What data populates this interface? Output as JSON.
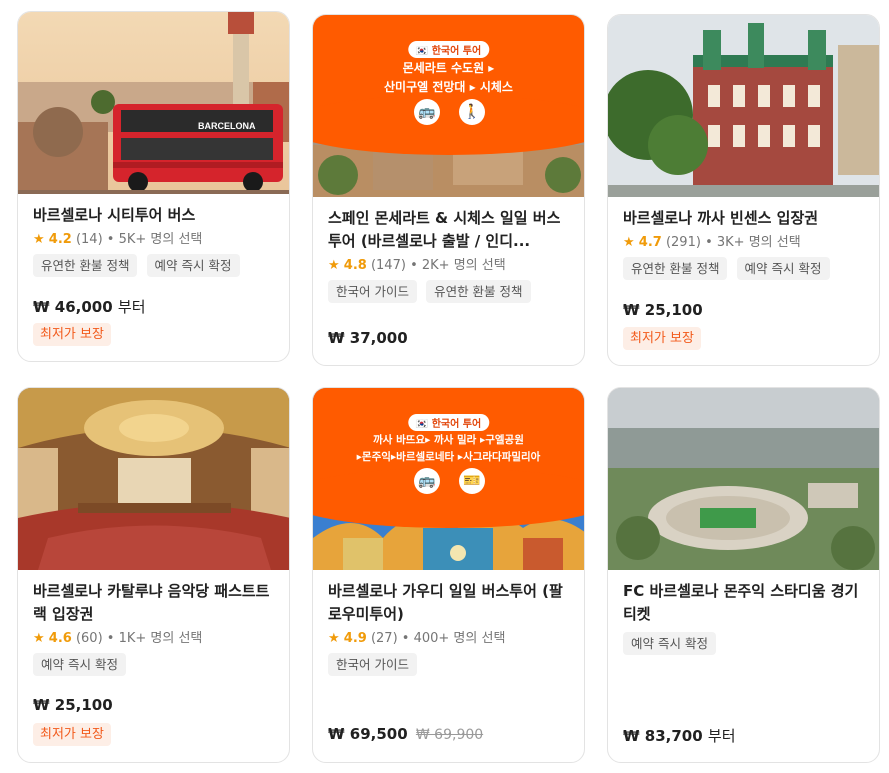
{
  "cards": [
    {
      "title": "바르셀로나 시티투어 버스",
      "star": "★",
      "score": "4.2",
      "reviews": "(14)",
      "booked": "• 5K+ 명의 선택",
      "tags": [
        "유연한 환불 정책",
        "예약 즉시 확정"
      ],
      "price": "₩ 46,000",
      "price_suffix": "부터",
      "badge": "최저가 보장"
    },
    {
      "title": "스페인 몬세라트 & 시체스 일일 버스투어 (바르셀로나 출발 / 인디...",
      "star": "★",
      "score": "4.8",
      "reviews": "(147)",
      "booked": "• 2K+ 명의 선택",
      "tags": [
        "한국어 가이드",
        "유연한 환불 정책"
      ],
      "price": "₩ 37,000",
      "banner": {
        "pill": "🇰🇷 한국어 투어",
        "line1": "몬세라트 수도원 ▸",
        "line2": "산미구엘 전망대 ▸ 시체스"
      }
    },
    {
      "title": "바르셀로나 까사 빈센스 입장권",
      "star": "★",
      "score": "4.7",
      "reviews": "(291)",
      "booked": "• 3K+ 명의 선택",
      "tags": [
        "유연한 환불 정책",
        "예약 즉시 확정"
      ],
      "price": "₩ 25,100",
      "badge": "최저가 보장"
    },
    {
      "title": "바르셀로나 카탈루냐 음악당 패스트트랙 입장권",
      "star": "★",
      "score": "4.6",
      "reviews": "(60)",
      "booked": "• 1K+ 명의 선택",
      "tags": [
        "예약 즉시 확정"
      ],
      "price": "₩ 25,100",
      "badge": "최저가 보장"
    },
    {
      "title": "바르셀로나 가우디 일일 버스투어 (팔로우미투어)",
      "star": "★",
      "score": "4.9",
      "reviews": "(27)",
      "booked": "• 400+ 명의 선택",
      "tags": [
        "한국어 가이드"
      ],
      "price": "₩ 69,500",
      "orig_price": "₩ 69,900",
      "banner": {
        "pill": "🇰🇷 한국어 투어",
        "line1": "까사 바뜨요▸ 까사 밀라 ▸구엘공원",
        "line2": "▸몬주익▸바르셀로네타 ▸사그라다파밀리아"
      }
    },
    {
      "title": "FC 바르셀로나 몬주익 스타디움 경기 티켓",
      "tags": [
        "예약 즉시 확정"
      ],
      "price": "₩ 83,700",
      "price_suffix": "부터"
    }
  ],
  "colors": {
    "accent": "#ff5b00",
    "star": "#f09b0a",
    "badge_text": "#f25a1b"
  }
}
